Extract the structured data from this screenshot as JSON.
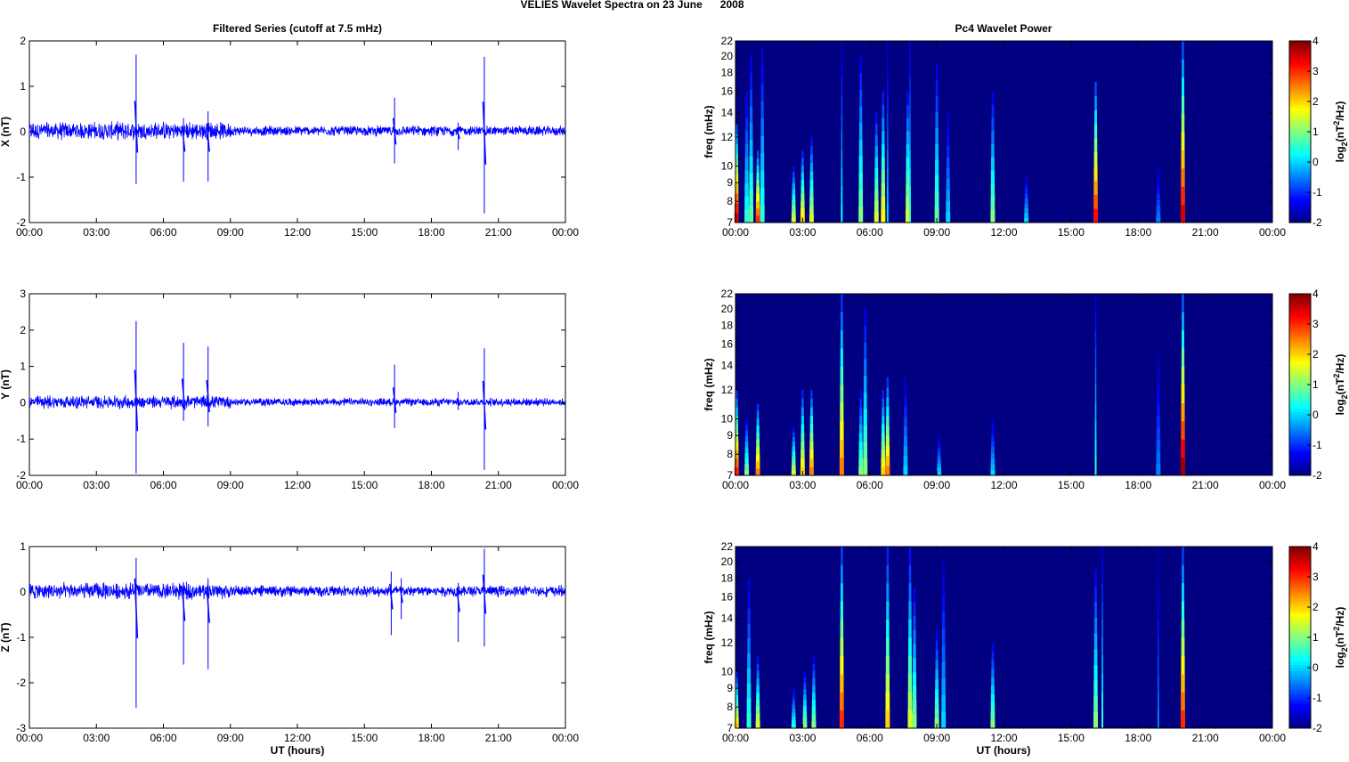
{
  "chart_data": {
    "title": "VELIES Wavelet Spectra on 23 June      2008",
    "left_title": "Filtered Series (cutoff at 7.5 mHz)",
    "right_title": "Pc4 Wavelet Power",
    "xlabel": "UT (hours)",
    "time_ticks": [
      "00:00",
      "03:00",
      "06:00",
      "09:00",
      "12:00",
      "15:00",
      "18:00",
      "21:00",
      "00:00"
    ],
    "xlim_hours": [
      0,
      24
    ],
    "freq_label": "freq (mHz)",
    "freq_ticks": [
      7,
      8,
      9,
      10,
      12,
      14,
      16,
      18,
      20,
      22
    ],
    "freq_scale": "log",
    "ylim_freq": [
      7,
      22
    ],
    "colorbar": {
      "label": "log2(nT²/Hz)",
      "label_base": "log",
      "label_sub": "2",
      "label_rest1": "(nT",
      "label_sup": "2",
      "label_rest2": "/Hz)",
      "ticks": [
        -2,
        -1,
        0,
        1,
        2,
        3,
        4
      ],
      "range": [
        -2,
        4
      ],
      "colormap": "jet"
    },
    "series": [
      {
        "type": "line",
        "name": "X",
        "ylabel": "X (nT)",
        "ylim": [
          -2,
          2
        ],
        "yticks": [
          -2,
          -1,
          0,
          1,
          2
        ],
        "color": "#0000ff",
        "noise": [
          {
            "t0": 0,
            "t1": 9,
            "amp": 0.16
          },
          {
            "t0": 9,
            "t1": 24,
            "amp": 0.09
          }
        ],
        "spikes": [
          {
            "t": 4.78,
            "max": 1.7,
            "min": -1.15
          },
          {
            "t": 6.9,
            "max": 0.3,
            "min": -1.1
          },
          {
            "t": 8.0,
            "max": 0.45,
            "min": -1.1
          },
          {
            "t": 16.35,
            "max": 0.75,
            "min": -0.7
          },
          {
            "t": 19.2,
            "max": 0.2,
            "min": -0.4
          },
          {
            "t": 20.37,
            "max": 1.65,
            "min": -1.8
          }
        ]
      },
      {
        "type": "line",
        "name": "Y",
        "ylabel": "Y (nT)",
        "ylim": [
          -2,
          3
        ],
        "yticks": [
          -2,
          -1,
          0,
          1,
          2,
          3
        ],
        "color": "#0000ff",
        "noise": [
          {
            "t0": 0,
            "t1": 9,
            "amp": 0.15
          },
          {
            "t0": 9,
            "t1": 24,
            "amp": 0.09
          }
        ],
        "spikes": [
          {
            "t": 4.78,
            "max": 2.25,
            "min": -1.95
          },
          {
            "t": 6.9,
            "max": 1.65,
            "min": -0.5
          },
          {
            "t": 8.0,
            "max": 1.55,
            "min": -0.65
          },
          {
            "t": 16.35,
            "max": 1.05,
            "min": -0.7
          },
          {
            "t": 19.2,
            "max": 0.3,
            "min": -0.2
          },
          {
            "t": 20.37,
            "max": 1.5,
            "min": -1.85
          }
        ]
      },
      {
        "type": "line",
        "name": "Z",
        "ylabel": "Z (nT)",
        "ylim": [
          -3,
          1
        ],
        "yticks": [
          -3,
          -2,
          -1,
          0,
          1
        ],
        "color": "#0000ff",
        "noise": [
          {
            "t0": 0,
            "t1": 9,
            "amp": 0.15
          },
          {
            "t0": 9,
            "t1": 24,
            "amp": 0.1
          }
        ],
        "spikes": [
          {
            "t": 4.78,
            "max": 0.75,
            "min": -2.55
          },
          {
            "t": 6.9,
            "max": 0.2,
            "min": -1.6
          },
          {
            "t": 8.0,
            "max": 0.3,
            "min": -1.7
          },
          {
            "t": 16.2,
            "max": 0.45,
            "min": -0.95
          },
          {
            "t": 16.65,
            "max": 0.3,
            "min": -0.6
          },
          {
            "t": 19.2,
            "max": 0.2,
            "min": -1.1
          },
          {
            "t": 20.37,
            "max": 0.95,
            "min": -1.2
          }
        ]
      }
    ],
    "wavelet": [
      {
        "type": "heatmap",
        "component": "X",
        "background": -2,
        "events": [
          {
            "t": 0.05,
            "fmax": 13,
            "p": 3.5
          },
          {
            "t": 0.5,
            "fmax": 16,
            "p": 0.5
          },
          {
            "t": 0.7,
            "fmax": 20,
            "p": 0.8
          },
          {
            "t": 1.0,
            "fmax": 11,
            "p": 3
          },
          {
            "t": 1.2,
            "fmax": 21,
            "p": 0.5
          },
          {
            "t": 2.6,
            "fmax": 10,
            "p": 1.5
          },
          {
            "t": 3.0,
            "fmax": 11,
            "p": 2
          },
          {
            "t": 3.4,
            "fmax": 12,
            "p": 1.5
          },
          {
            "t": 4.75,
            "fmax": 22,
            "p": 0.3
          },
          {
            "t": 5.6,
            "fmax": 20,
            "p": 1
          },
          {
            "t": 6.3,
            "fmax": 14,
            "p": 1.5
          },
          {
            "t": 6.6,
            "fmax": 16,
            "p": 1.8
          },
          {
            "t": 6.8,
            "fmax": 22,
            "p": 0
          },
          {
            "t": 7.7,
            "fmax": 16,
            "p": 1.5
          },
          {
            "t": 7.8,
            "fmax": 22,
            "p": 0.5
          },
          {
            "t": 9.0,
            "fmax": 19,
            "p": 0.8
          },
          {
            "t": 9.5,
            "fmax": 14,
            "p": 0
          },
          {
            "t": 11.5,
            "fmax": 16,
            "p": 1
          },
          {
            "t": 13.0,
            "fmax": 9.5,
            "p": 0
          },
          {
            "t": 16.1,
            "fmax": 17,
            "p": 3.2
          },
          {
            "t": 18.9,
            "fmax": 10,
            "p": -0.5
          },
          {
            "t": 20.0,
            "fmax": 22,
            "p": 3.5
          }
        ]
      },
      {
        "type": "heatmap",
        "component": "Y",
        "background": -2,
        "events": [
          {
            "t": 0.05,
            "fmax": 12,
            "p": 3
          },
          {
            "t": 0.5,
            "fmax": 10,
            "p": 1
          },
          {
            "t": 1.0,
            "fmax": 11,
            "p": 2.5
          },
          {
            "t": 2.6,
            "fmax": 9.5,
            "p": 1.5
          },
          {
            "t": 3.0,
            "fmax": 12,
            "p": 2
          },
          {
            "t": 3.4,
            "fmax": 12,
            "p": 2.5
          },
          {
            "t": 4.75,
            "fmax": 22,
            "p": 2.5
          },
          {
            "t": 5.6,
            "fmax": 12,
            "p": 1
          },
          {
            "t": 5.8,
            "fmax": 20,
            "p": 1
          },
          {
            "t": 6.6,
            "fmax": 12,
            "p": 2
          },
          {
            "t": 6.8,
            "fmax": 13,
            "p": 2.5
          },
          {
            "t": 7.6,
            "fmax": 13,
            "p": 0
          },
          {
            "t": 9.1,
            "fmax": 9,
            "p": 0
          },
          {
            "t": 11.5,
            "fmax": 10,
            "p": 0
          },
          {
            "t": 16.1,
            "fmax": 22,
            "p": 0.5
          },
          {
            "t": 18.9,
            "fmax": 15,
            "p": -0.5
          },
          {
            "t": 20.0,
            "fmax": 22,
            "p": 3.8
          }
        ]
      },
      {
        "type": "heatmap",
        "component": "Z",
        "background": -2,
        "events": [
          {
            "t": 0.05,
            "fmax": 10,
            "p": 2
          },
          {
            "t": 0.6,
            "fmax": 18,
            "p": 0.5
          },
          {
            "t": 1.0,
            "fmax": 11,
            "p": 1.5
          },
          {
            "t": 2.6,
            "fmax": 9,
            "p": 0.5
          },
          {
            "t": 3.1,
            "fmax": 10,
            "p": 1
          },
          {
            "t": 3.5,
            "fmax": 11,
            "p": 1
          },
          {
            "t": 4.75,
            "fmax": 22,
            "p": 3
          },
          {
            "t": 6.8,
            "fmax": 22,
            "p": 2
          },
          {
            "t": 7.8,
            "fmax": 22,
            "p": 1.5
          },
          {
            "t": 8.0,
            "fmax": 17,
            "p": 1
          },
          {
            "t": 9.0,
            "fmax": 13,
            "p": 1
          },
          {
            "t": 9.3,
            "fmax": 20,
            "p": 0
          },
          {
            "t": 11.5,
            "fmax": 12,
            "p": 1
          },
          {
            "t": 16.1,
            "fmax": 19,
            "p": 1
          },
          {
            "t": 16.4,
            "fmax": 22,
            "p": 0.5
          },
          {
            "t": 18.9,
            "fmax": 22,
            "p": -0.5
          },
          {
            "t": 20.0,
            "fmax": 22,
            "p": 3
          }
        ]
      }
    ]
  }
}
